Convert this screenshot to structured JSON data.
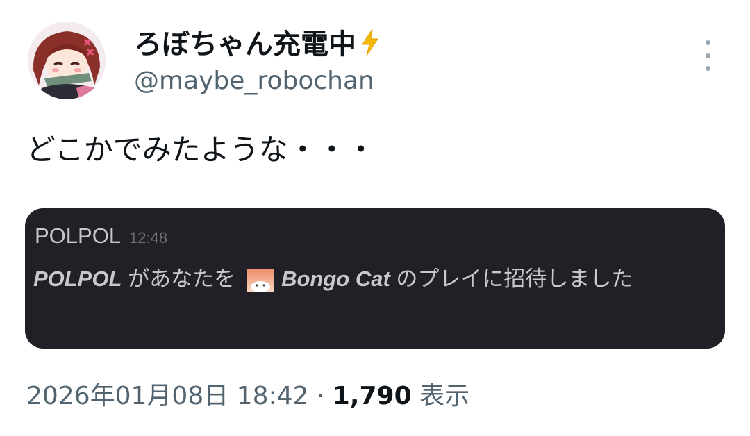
{
  "author": {
    "display_name": "ろぼちゃん充電中",
    "handle": "@maybe_robochan",
    "avatar_icon": "avatar-icon",
    "badge_icon": "lightning-bolt-icon"
  },
  "tweet": {
    "text": "どこかでみたような・・・"
  },
  "embed": {
    "username": "POLPOL",
    "time": "12:48",
    "actor": "POLPOL",
    "invite_text_1": " があなたを",
    "game_name": "Bongo Cat",
    "invite_text_2": " のプレイに招待しました"
  },
  "meta": {
    "datetime": "2026年01月08日 18:42",
    "separator": " · ",
    "views": "1,790",
    "views_label": " 表示"
  },
  "menu": {
    "more_icon": "more-vertical-icon"
  },
  "colors": {
    "text": "#0f1419",
    "secondary": "#536471",
    "embed_bg": "#202026",
    "embed_text": "#c8c8cc",
    "bolt": "#f5b800"
  }
}
